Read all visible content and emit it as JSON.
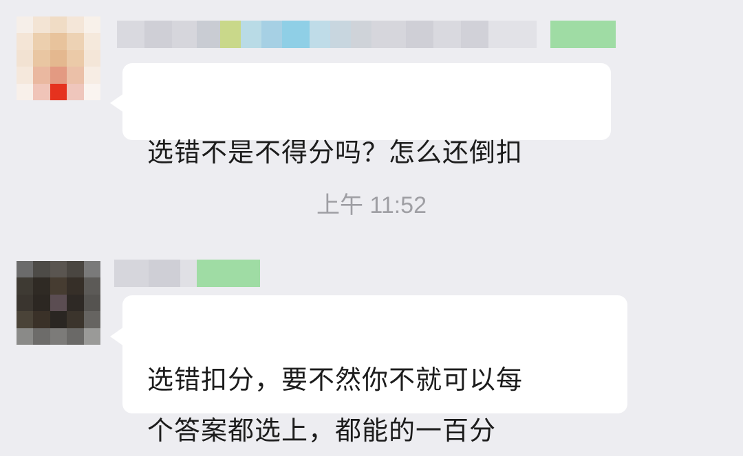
{
  "messages": [
    {
      "text": "选错不是不得分吗？怎么还倒扣"
    },
    {
      "text": "选错扣分，要不然你不就可以每\n个答案都选上，都能的一百分"
    }
  ],
  "timestamp": "上午 11:52"
}
